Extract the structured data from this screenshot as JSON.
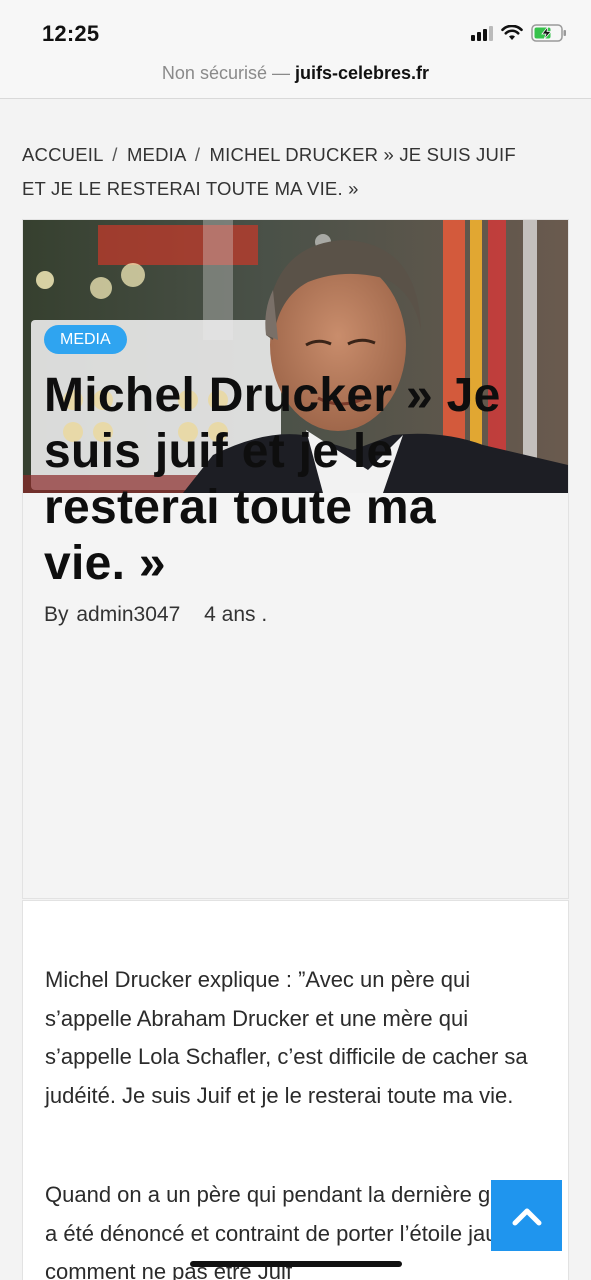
{
  "status_bar": {
    "time": "12:25"
  },
  "url_bar": {
    "insecure_label": "Non sécurisé —",
    "domain": "juifs-celebres.fr"
  },
  "breadcrumb": {
    "home": "ACCUEIL",
    "separator": "/",
    "category": "MEDIA",
    "current": "MICHEL DRUCKER  » JE SUIS JUIF ET JE LE RESTERAI TOUTE MA VIE. »"
  },
  "article": {
    "category_badge": "MEDIA",
    "title": "Michel Drucker  » Je suis juif et je le resterai toute ma vie. »",
    "meta": {
      "by_label": "By",
      "author": "admin3047",
      "date": "4 ans ."
    },
    "paragraphs": [
      "Michel Drucker explique :  ”Avec un père qui s’appelle Abraham Drucker et une mère qui s’appelle Lola Schafler, c’est difficile de cacher sa judéité. Je suis Juif et je le resterai toute ma vie.",
      "Quand on a un père qui pendant la dernière guerre a été dénoncé et contraint de porter l’étoile jaune, comment ne pas être Juif"
    ]
  },
  "colors": {
    "accent": "#2fa4f0",
    "scroll_button": "#1f95ee"
  },
  "icons": {
    "scroll_top": "chevron-up-icon",
    "signal": "signal-icon",
    "wifi": "wifi-icon",
    "battery": "battery-charging-icon"
  }
}
